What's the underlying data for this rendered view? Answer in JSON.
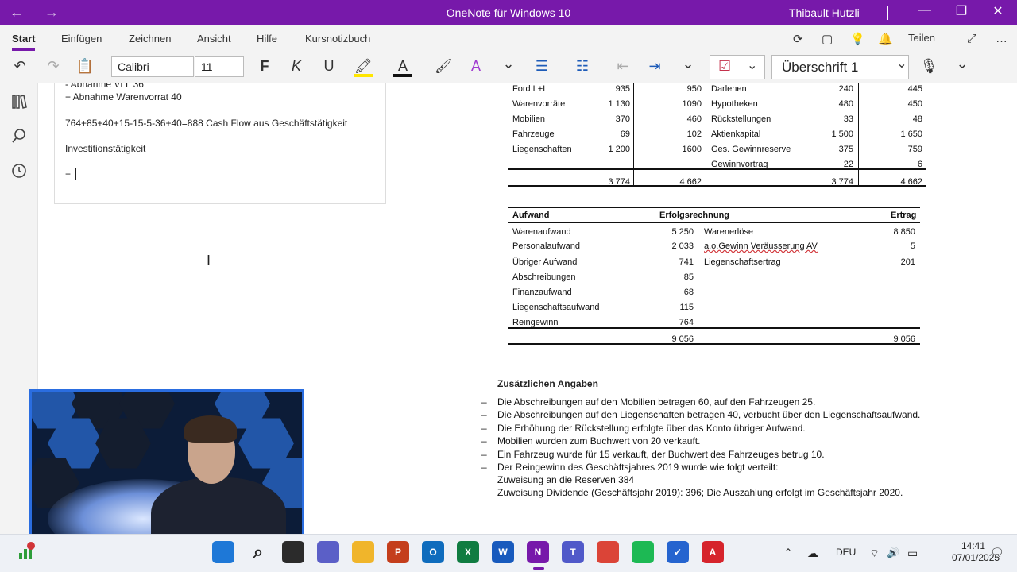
{
  "titlebar": {
    "title": "OneNote für Windows 10",
    "user": "Thibault Hutzli",
    "back_glyph": "←",
    "forward_glyph": "→",
    "minimize_glyph": "—",
    "restore_glyph": "❐",
    "close_glyph": "✕",
    "color": "#7719aa"
  },
  "ribbon": {
    "tabs": [
      "Start",
      "Einfügen",
      "Zeichnen",
      "Ansicht",
      "Hilfe",
      "Kursnotizbuch"
    ],
    "active_tab": "Start",
    "share_label": "Teilen",
    "font_name": "Calibri",
    "font_size": "11",
    "bold": "F",
    "italic": "K",
    "underline": "U",
    "style": "Überschrift 1",
    "icons": {
      "sync": "⟳",
      "page": "▢",
      "idea": "💡",
      "bell": "🔔",
      "expand": "⤢",
      "more": "…",
      "undo": "↶",
      "redo": "↷",
      "paste": "📋",
      "highlight": "🖍",
      "font_color": "A",
      "format_painter": "🖌",
      "clear_format": "A",
      "bullets": "☰",
      "numbering": "☷",
      "outdent": "⇤",
      "indent": "⇥",
      "chevron": "⌄",
      "todo": "☑",
      "mic": "🎙"
    }
  },
  "sidebar": {
    "icons": [
      "notebooks-icon",
      "search-icon",
      "recent-icon"
    ]
  },
  "note": {
    "lines": [
      "- Abnahme VLL 36",
      "+ Abnahme Warenvorrat 40",
      "764+85+40+15-15-5-36+40=888 Cash Flow aus Geschäftstätigkeit",
      "Investitionstätigkeit",
      "+"
    ]
  },
  "bilanz": {
    "left_rows": [
      {
        "label": "Ford L+L",
        "v1": "935",
        "v2": "950"
      },
      {
        "label": "Warenvorräte",
        "v1": "1 130",
        "v2": "1090"
      },
      {
        "label": "Mobilien",
        "v1": "370",
        "v2": "460"
      },
      {
        "label": "Fahrzeuge",
        "v1": "69",
        "v2": "102"
      },
      {
        "label": "Liegenschaften",
        "v1": "1 200",
        "v2": "1600"
      }
    ],
    "right_rows": [
      {
        "label": "Darlehen",
        "v1": "240",
        "v2": "445"
      },
      {
        "label": "Hypotheken",
        "v1": "480",
        "v2": "450"
      },
      {
        "label": "Rückstellungen",
        "v1": "33",
        "v2": "48"
      },
      {
        "label": "Aktienkapital",
        "v1": "1 500",
        "v2": "1 650"
      },
      {
        "label": "Ges. Gewinnreserve",
        "v1": "375",
        "v2": "759"
      },
      {
        "label": "Gewinnvortrag",
        "v1": "22",
        "v2": "6"
      }
    ],
    "totals": {
      "l1": "3 774",
      "l2": "4 662",
      "r1": "3 774",
      "r2": "4 662"
    }
  },
  "erfolgsrechnung": {
    "head_left": "Aufwand",
    "head_center": "Erfolgsrechnung",
    "head_right": "Ertrag",
    "aufwand": [
      {
        "label": "Warenaufwand",
        "value": "5 250"
      },
      {
        "label": "Personalaufwand",
        "value": "2 033"
      },
      {
        "label": "Übriger Aufwand",
        "value": "741"
      },
      {
        "label": "Abschreibungen",
        "value": "85"
      },
      {
        "label": "Finanzaufwand",
        "value": "68"
      },
      {
        "label": "Liegenschaftsaufwand",
        "value": "115"
      },
      {
        "label": "Reingewinn",
        "value": "764"
      }
    ],
    "ertrag": [
      {
        "label": "Warenerlöse",
        "value": "8 850"
      },
      {
        "label": "a.o.Gewinn Veräusserung AV",
        "value": "5"
      },
      {
        "label": "Liegenschaftsertrag",
        "value": "201"
      }
    ],
    "total_left": "9 056",
    "total_right": "9 056"
  },
  "angaben": {
    "title": "Zusätzlichen Angaben",
    "dash": "–",
    "items": [
      "Die Abschreibungen auf den Mobilien betragen 60, auf den Fahrzeugen 25.",
      "Die Abschreibungen auf den Liegenschaften betragen 40, verbucht über den Liegenschaftsaufwand.",
      "Die Erhöhung der Rückstellung erfolgte über das Konto übriger Aufwand.",
      "Mobilien wurden zum Buchwert von 20 verkauft.",
      "Ein Fahrzeug wurde für 15 verkauft, der Buchwert des Fahrzeuges betrug 10.",
      "Der Reingewinn des Geschäftsjahres 2019 wurde wie folgt verteilt:"
    ],
    "sub_items": [
      "Zuweisung an die Reserven 384",
      "Zuweisung Dividende (Geschäftsjahr 2019): 396; Die Auszahlung erfolgt im Geschäftsjahr 2020."
    ]
  },
  "taskbar": {
    "apps": [
      {
        "name": "windows-start-icon",
        "label": "",
        "color": "#1e78d7"
      },
      {
        "name": "search-icon",
        "label": "⌕",
        "color": "#eef1f6"
      },
      {
        "name": "task-view-icon",
        "label": "",
        "color": "#2b2b2b"
      },
      {
        "name": "meet-icon",
        "label": "",
        "color": "#5b5fc7"
      },
      {
        "name": "file-explorer-icon",
        "label": "",
        "color": "#f0b52b"
      },
      {
        "name": "powerpoint-icon",
        "label": "P",
        "color": "#c43e1c"
      },
      {
        "name": "outlook-icon",
        "label": "O",
        "color": "#0f6cbd"
      },
      {
        "name": "excel-icon",
        "label": "X",
        "color": "#107c41"
      },
      {
        "name": "word-icon",
        "label": "W",
        "color": "#185abd"
      },
      {
        "name": "onenote-icon",
        "label": "N",
        "color": "#7719aa"
      },
      {
        "name": "teams-icon",
        "label": "T",
        "color": "#5059c9"
      },
      {
        "name": "chrome-icon",
        "label": "",
        "color": "#db4437"
      },
      {
        "name": "spotify-icon",
        "label": "",
        "color": "#1db954"
      },
      {
        "name": "todo-icon",
        "label": "✓",
        "color": "#2564cf"
      },
      {
        "name": "acrobat-icon",
        "label": "A",
        "color": "#d6242c"
      }
    ],
    "language": "DEU",
    "time": "14:41",
    "date": "07/01/2025",
    "chevron_up": "⌃",
    "cloud": "☁",
    "wifi": "⌔",
    "volume": "🔊",
    "battery": "▭"
  }
}
